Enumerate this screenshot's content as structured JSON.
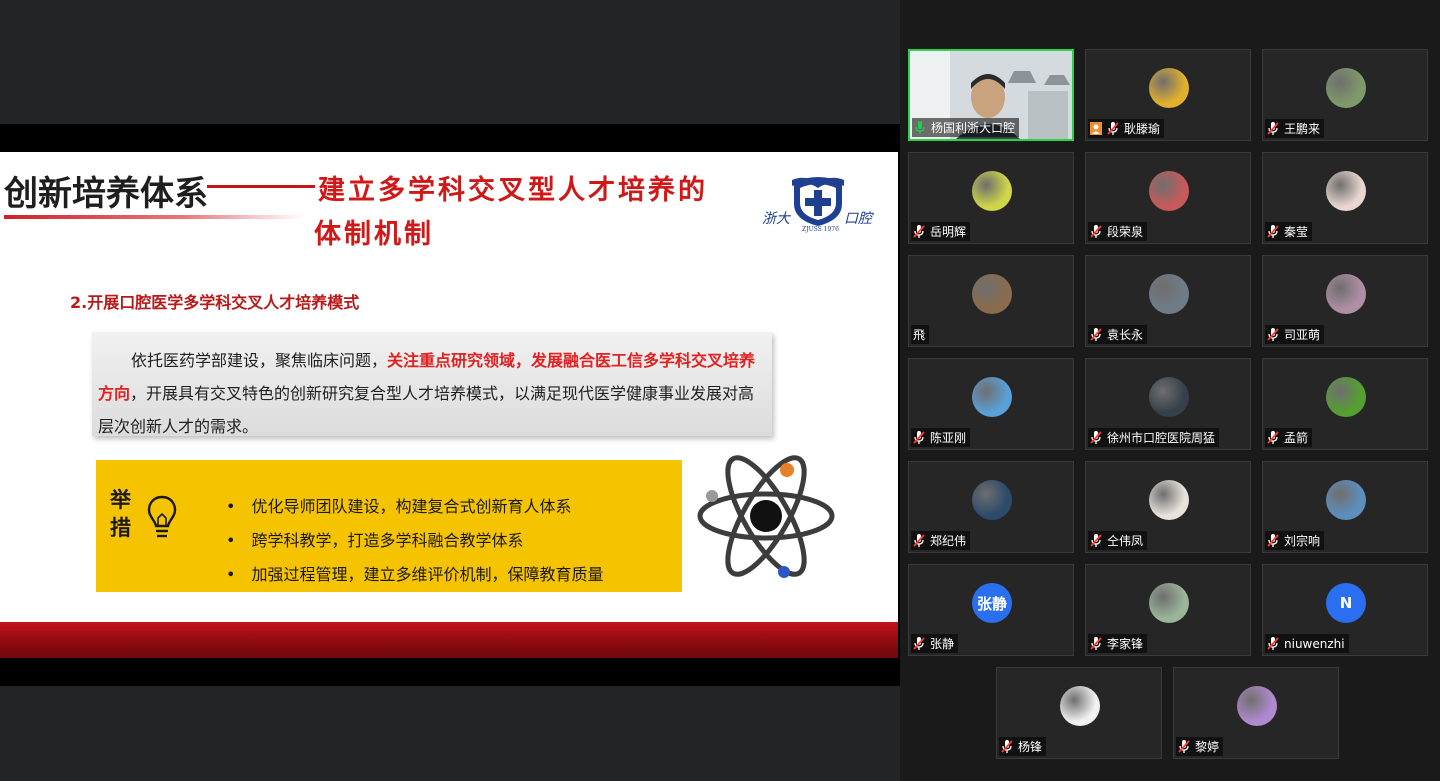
{
  "slide": {
    "title_main": "创新培养体系",
    "title_sub_line1": "建立多学科交叉型人才培养的",
    "title_sub_line2": "体制机制",
    "logo": {
      "left_text": "浙大",
      "right_text": "口腔",
      "year": "ZJUSS 1976"
    },
    "section_title": "2.开展口腔医学多学科交叉人才培养模式",
    "paragraph": {
      "part1": "依托医药学部建设，聚焦临床问题，",
      "highlight": "关注重点研究领域，发展融合医工信多学科交叉培养方向",
      "part2": "，开展具有交叉特色的创新研究复合型人才培养模式，以满足现代医学健康事业发展对高层次创新人才的需求。"
    },
    "measures_label": "举措",
    "measures": [
      "优化导师团队建设，构建复合式创新育人体系",
      "跨学科教学，打造多学科融合教学体系",
      "加强过程管理，建立多维评价机制，保障教育质量"
    ]
  },
  "participants": [
    {
      "name": "杨国利浙大口腔",
      "type": "video",
      "mic": "on",
      "active": true
    },
    {
      "name": "耿滕瑜",
      "type": "photo",
      "color": "#e2b02c",
      "mic": "muted",
      "extra_icon": "person-icon"
    },
    {
      "name": "王鹏来",
      "type": "photo",
      "color": "#7f9a6a",
      "mic": "muted"
    },
    {
      "name": "岳明辉",
      "type": "photo",
      "color": "#cfd64a",
      "mic": "muted"
    },
    {
      "name": "段荣泉",
      "type": "photo",
      "color": "#c85a5a",
      "mic": "muted"
    },
    {
      "name": "秦莹",
      "type": "photo",
      "color": "#e8d6cf",
      "mic": "muted"
    },
    {
      "name": "飛",
      "type": "photo",
      "color": "#8a6b4b",
      "mic": "none"
    },
    {
      "name": "袁长永",
      "type": "photo",
      "color": "#6f7c88",
      "mic": "muted"
    },
    {
      "name": "司亚萌",
      "type": "photo",
      "color": "#b08ea4",
      "mic": "muted"
    },
    {
      "name": "陈亚刚",
      "type": "photo",
      "color": "#5aa0d8",
      "mic": "muted"
    },
    {
      "name": "徐州市口腔医院周猛",
      "type": "photo",
      "color": "#35404a",
      "mic": "muted"
    },
    {
      "name": "孟箭",
      "type": "photo",
      "color": "#55a030",
      "mic": "muted"
    },
    {
      "name": "郑纪伟",
      "type": "photo",
      "color": "#2c4a6a",
      "mic": "muted"
    },
    {
      "name": "仝伟凤",
      "type": "photo",
      "color": "#e8e2dc",
      "mic": "muted"
    },
    {
      "name": "刘宗响",
      "type": "photo",
      "color": "#5d8fbd",
      "mic": "muted"
    },
    {
      "name": "张静",
      "type": "initials",
      "initials": "张静",
      "color": "#2a6ff0",
      "mic": "muted"
    },
    {
      "name": "李家锋",
      "type": "photo",
      "color": "#9bb59a",
      "mic": "muted"
    },
    {
      "name": "niuwenzhi",
      "type": "initials",
      "initials": "N",
      "color": "#2a6ff0",
      "mic": "muted"
    },
    {
      "name": "杨锋",
      "type": "photo",
      "color": "#f1f1f1",
      "mic": "muted"
    },
    {
      "name": "黎婷",
      "type": "photo",
      "color": "#b08ad0",
      "mic": "muted"
    }
  ]
}
